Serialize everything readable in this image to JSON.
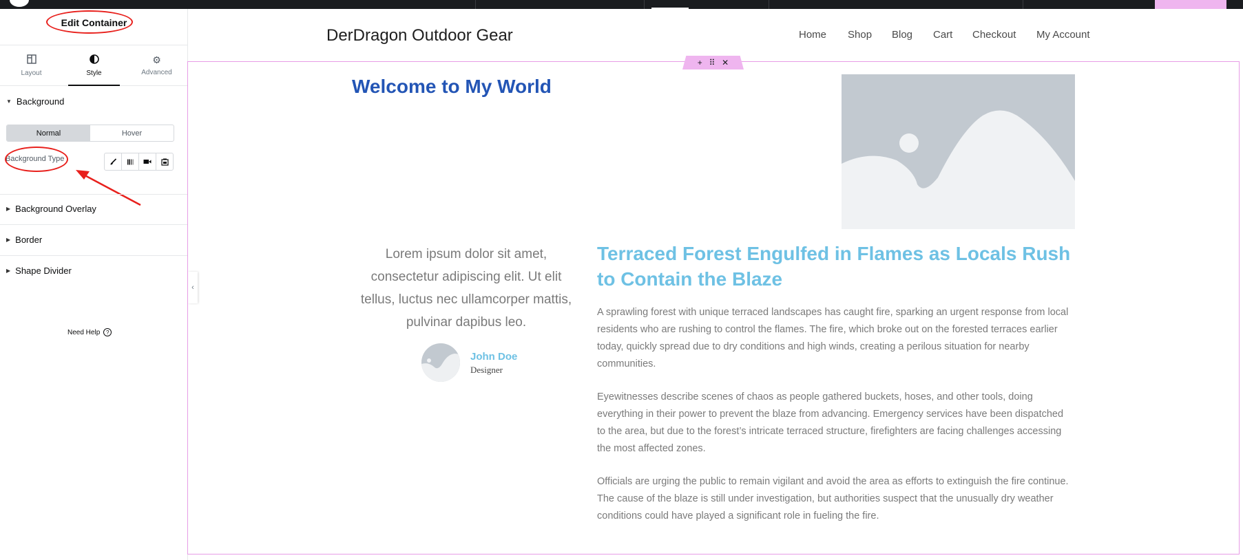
{
  "panel": {
    "title": "Edit Container",
    "tabs": [
      {
        "label": "Layout",
        "icon": "layout-icon"
      },
      {
        "label": "Style",
        "icon": "half-circle-icon"
      },
      {
        "label": "Advanced",
        "icon": "gear-icon"
      }
    ],
    "sections": {
      "background": "Background",
      "background_overlay": "Background Overlay",
      "border": "Border",
      "shape_divider": "Shape Divider"
    },
    "state_switch": {
      "normal": "Normal",
      "hover": "Hover"
    },
    "background_type_label": "Background Type",
    "background_type_options": [
      "classic-brush-icon",
      "gradient-icon",
      "video-icon",
      "slideshow-icon"
    ],
    "need_help": "Need Help"
  },
  "site": {
    "title": "DerDragon Outdoor Gear",
    "nav": [
      "Home",
      "Shop",
      "Blog",
      "Cart",
      "Checkout",
      "My Account"
    ]
  },
  "content": {
    "welcome": "Welcome to My World",
    "testimonial": {
      "text": "Lorem ipsum dolor sit amet, consectetur adipiscing elit. Ut elit tellus, luctus nec ullamcorper mattis, pulvinar dapibus leo.",
      "name": "John Doe",
      "role": "Designer"
    },
    "headline": "Terraced Forest Engulfed in Flames as Locals Rush to Contain the Blaze",
    "paragraphs": [
      "A sprawling forest with unique terraced landscapes has caught fire, sparking an urgent response from local residents who are rushing to control the flames. The fire, which broke out on the forested terraces earlier today, quickly spread due to dry conditions and high winds, creating a perilous situation for nearby communities.",
      "Eyewitnesses describe scenes of chaos as people gathered buckets, hoses, and other tools, doing everything in their power to prevent the blaze from advancing. Emergency services have been dispatched to the area, but due to the forest’s intricate terraced structure, firefighters are facing challenges accessing the most affected zones.",
      "Officials are urging the public to remain vigilant and avoid the area as efforts to extinguish the fire continue. The cause of the blaze is still under investigation, but authorities suspect that the unusually dry weather conditions could have played a significant role in fueling the fire."
    ]
  },
  "colors": {
    "accent_blue": "#2355b5",
    "light_blue": "#6ec1e4",
    "container_outline": "#e79ce6",
    "annotation_red": "#e8201c"
  }
}
